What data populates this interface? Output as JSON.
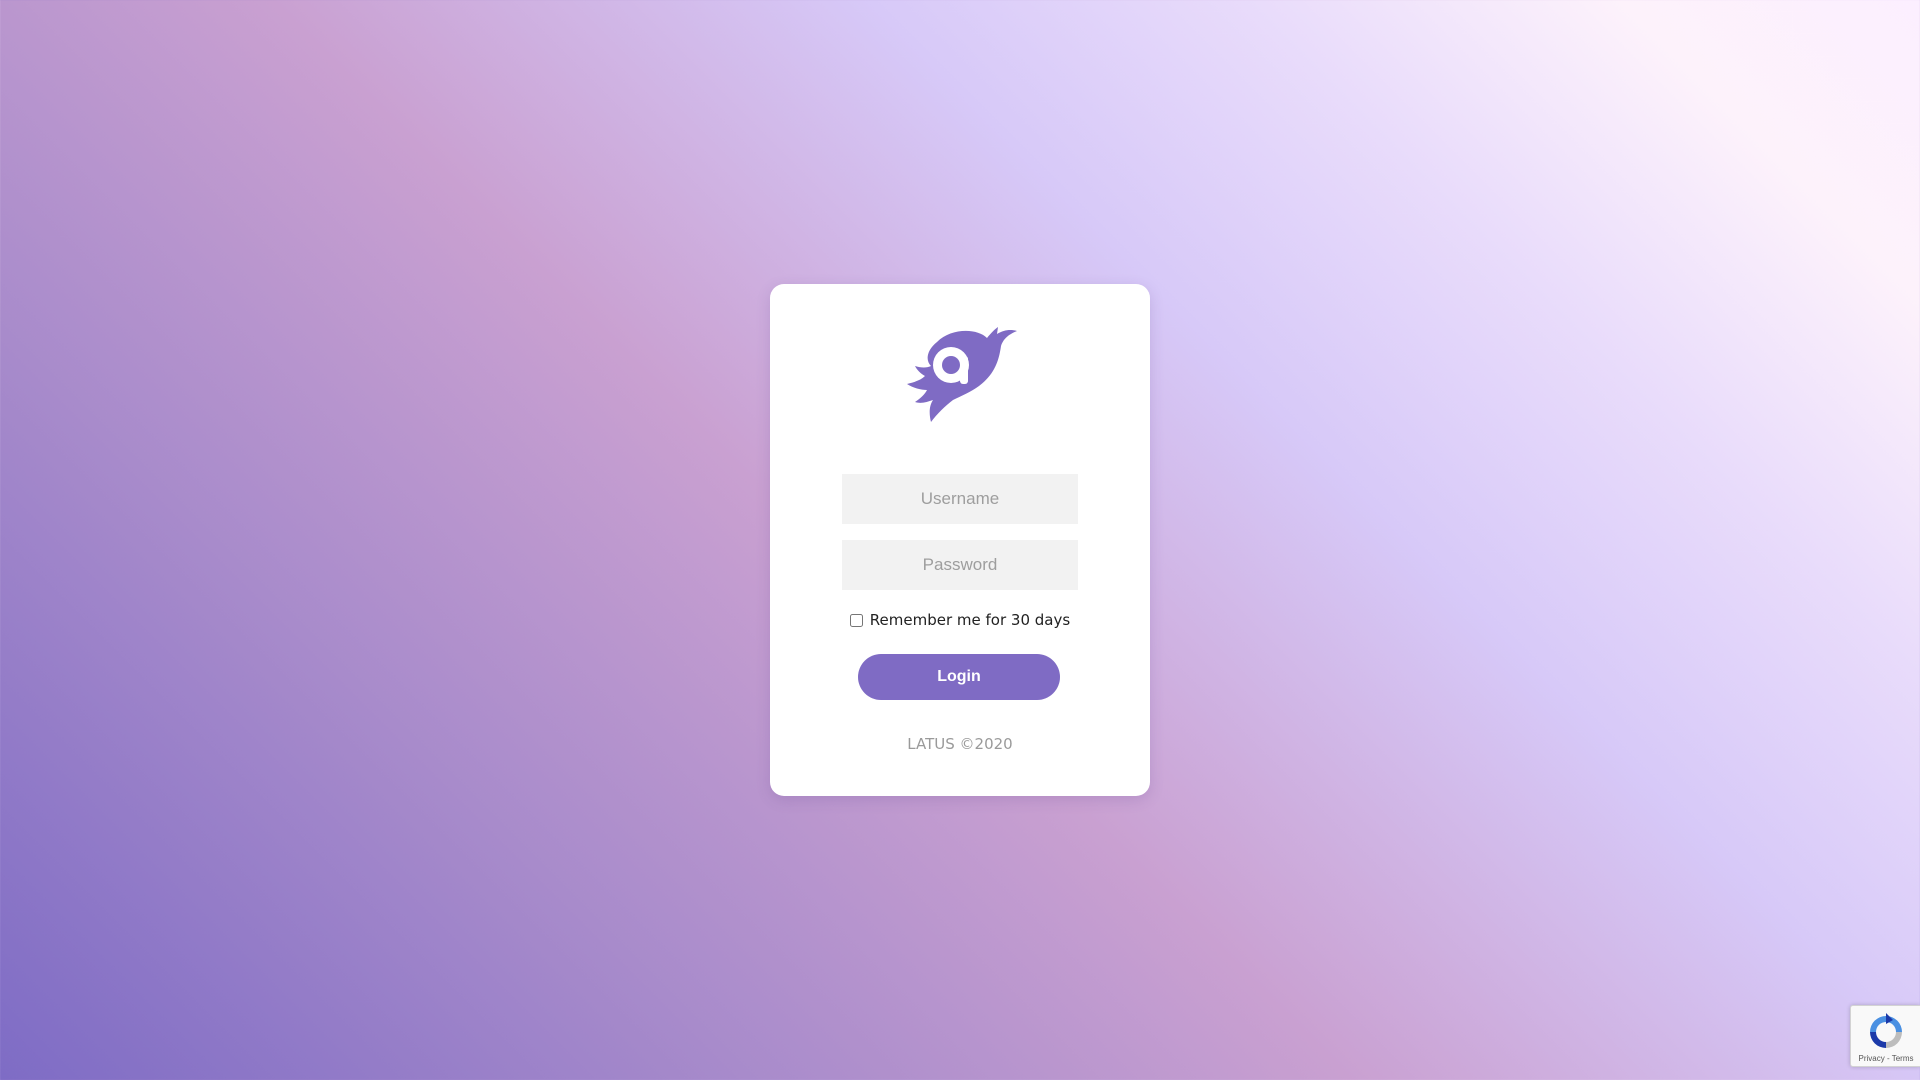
{
  "colors": {
    "accent": "#7f6bc4",
    "card": "#ffffff",
    "input_background": "#f2f2f2"
  },
  "login": {
    "logo_icon": "latus-bird-logo",
    "username_placeholder": "Username",
    "password_placeholder": "Password",
    "remember_label": "Remember me for 30 days",
    "remember_checked": false,
    "login_label": "Login",
    "footer": "LATUS ©2020"
  },
  "recaptcha": {
    "icon": "recaptcha-icon",
    "privacy_label": "Privacy",
    "separator": " - ",
    "terms_label": "Terms"
  }
}
